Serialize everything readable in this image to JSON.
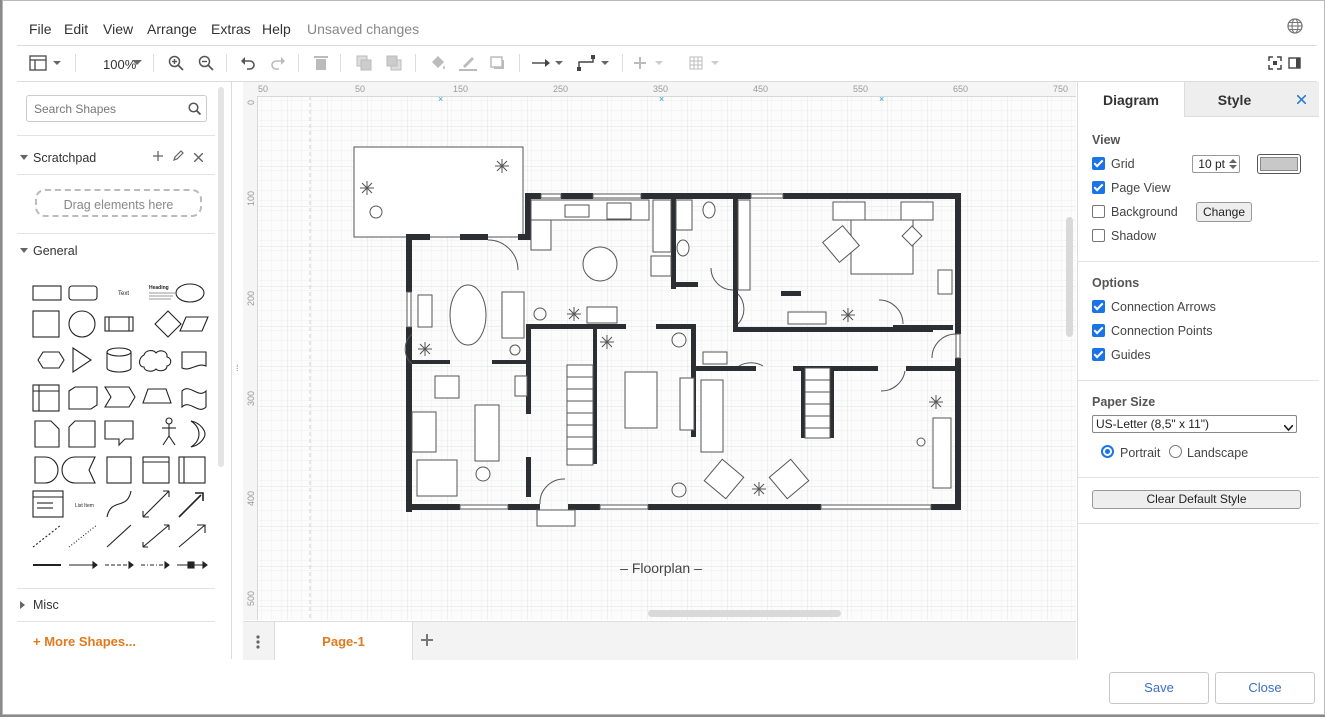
{
  "menubar": {
    "items": [
      "File",
      "Edit",
      "View",
      "Arrange",
      "Extras",
      "Help"
    ],
    "status": "Unsaved changes"
  },
  "toolbar": {
    "zoom": "100%"
  },
  "sidebar": {
    "search_placeholder": "Search Shapes",
    "scratchpad_title": "Scratchpad",
    "dropzone_text": "Drag elements here",
    "general_title": "General",
    "misc_title": "Misc",
    "more_shapes": "+ More Shapes..."
  },
  "canvas": {
    "ruler_top": [
      "50",
      "50",
      "150",
      "250",
      "350",
      "450",
      "550",
      "650",
      "750"
    ],
    "ruler_left": [
      "0",
      "100",
      "200",
      "300",
      "400",
      "500"
    ],
    "diagram_title": "– Floorplan –"
  },
  "pages": {
    "current": "Page-1"
  },
  "panel": {
    "tabs": [
      "Diagram",
      "Style"
    ],
    "view_title": "View",
    "grid_label": "Grid",
    "grid_size": "10 pt",
    "page_view_label": "Page View",
    "background_label": "Background",
    "change_button": "Change",
    "shadow_label": "Shadow",
    "options_title": "Options",
    "connection_arrows": "Connection Arrows",
    "connection_points": "Connection Points",
    "guides": "Guides",
    "paper_size_title": "Paper Size",
    "paper_size_value": "US-Letter (8,5\" x 11\")",
    "portrait": "Portrait",
    "landscape": "Landscape",
    "clear_default_style": "Clear Default Style",
    "checks": {
      "grid": true,
      "page_view": true,
      "background": false,
      "shadow": false,
      "connection_arrows": true,
      "connection_points": true,
      "guides": true
    },
    "orientation": "portrait"
  },
  "footer": {
    "save": "Save",
    "close": "Close"
  },
  "colors": {
    "accent": "#1a73e8",
    "orange": "#e07a1f",
    "wall": "#2b2f33"
  }
}
